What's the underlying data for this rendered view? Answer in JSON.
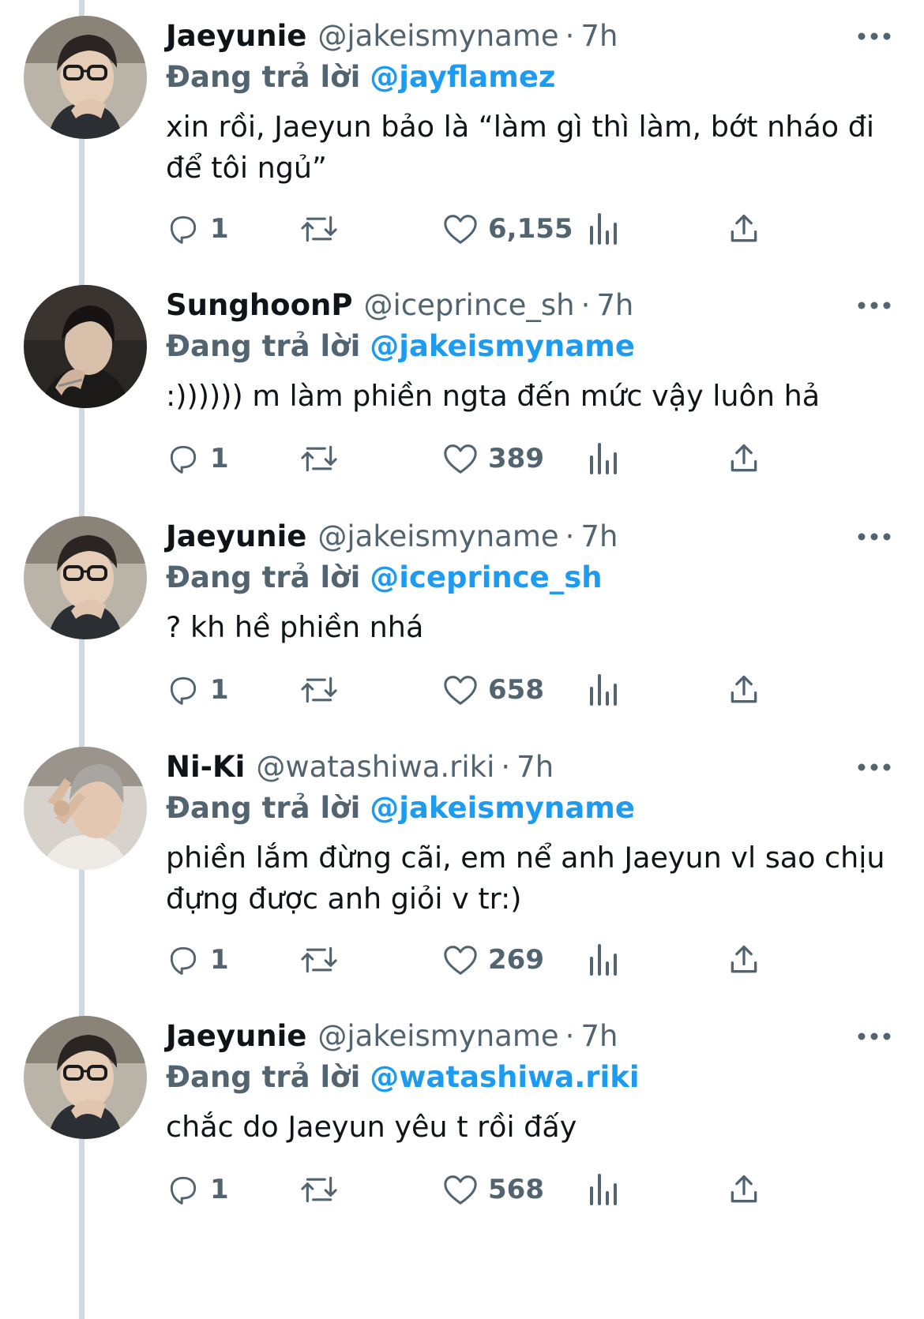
{
  "replying_label": "Đang trả lời",
  "colors": {
    "link": "#1d9bf0",
    "secondary": "#536471",
    "thread_line": "#cfd9de"
  },
  "tweets": [
    {
      "display_name": "Jaeyunie",
      "handle": "@jakeismyname",
      "separator": "·",
      "time": "7h",
      "replying_to": "@jayflamez",
      "text": "xin rồi, Jaeyun bảo là “làm gì thì làm, bớt nháo đi để tôi ngủ”",
      "replies": "1",
      "likes": "6,155",
      "avatar": "glasses-portrait"
    },
    {
      "display_name": "SunghoonP",
      "handle": "@iceprince_sh",
      "separator": "·",
      "time": "7h",
      "replying_to": "@jakeismyname",
      "text": ":)))))) m làm phiền ngta đến mức vậy luôn hả",
      "replies": "1",
      "likes": "389",
      "avatar": "dark-portrait"
    },
    {
      "display_name": "Jaeyunie",
      "handle": "@jakeismyname",
      "separator": "·",
      "time": "7h",
      "replying_to": "@iceprince_sh",
      "text": "? kh hề phiền nhá",
      "replies": "1",
      "likes": "658",
      "avatar": "glasses-portrait"
    },
    {
      "display_name": "Ni-Ki",
      "handle": "@watashiwa.riki",
      "separator": "·",
      "time": "7h",
      "replying_to": "@jakeismyname",
      "text": "phiền lắm đừng cãi, em nể anh Jaeyun vl sao chịu đựng được anh giỏi v tr:)",
      "replies": "1",
      "likes": "269",
      "avatar": "gray-hair-portrait"
    },
    {
      "display_name": "Jaeyunie",
      "handle": "@jakeismyname",
      "separator": "·",
      "time": "7h",
      "replying_to": "@watashiwa.riki",
      "text": "chắc do Jaeyun yêu t rồi đấy",
      "replies": "1",
      "likes": "568",
      "avatar": "glasses-portrait"
    }
  ],
  "icons": {
    "reply": "speech-bubble-icon",
    "retweet": "retweet-icon",
    "like": "heart-icon",
    "views": "bar-chart-icon",
    "share": "share-upload-icon",
    "more": "more-dots-icon"
  }
}
